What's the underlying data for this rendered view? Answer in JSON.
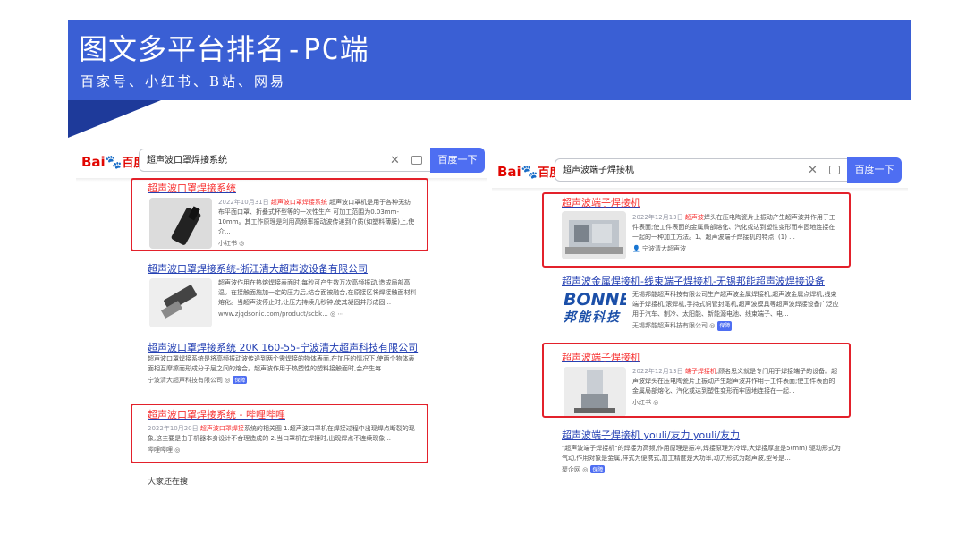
{
  "banner": {
    "title": "图文多平台排名-PC端",
    "subtitle": "百家号、小红书、B站、网易"
  },
  "colors": {
    "banner": "#3a5fd4",
    "banner_tab": "#1e3a9a",
    "highlight": "#e3212b",
    "link": "#2440b3",
    "baidu_button": "#4e6ef2"
  },
  "left_panel": {
    "logo": {
      "text_bai": "Bai",
      "text_du": "du",
      "text_cn": "百度"
    },
    "query": "超声波口罩焊接系统",
    "search_button": "百度一下",
    "results": [
      {
        "title": "超声波口罩焊接系统",
        "date": "2022年10月31日",
        "snippet_hl": "超声波口罩焊接系统",
        "snippet": "超声波口罩机是用于各种无纺布平面口罩、折叠式杯型等的一次性生产 可加工范围为0.03mm-10mm。其工作原理是利用高频率振动波传递到介质(如塑料薄膜)上,使介...",
        "source": "小红书"
      },
      {
        "title": "超声波口罩焊接系统-浙江清大超声波设备有限公司",
        "snippet": "超声波作用在热熔焊接表面时,每秒可产生数万次高频振动,造成局部高温。在接触面施加一定的压力后,结合面被融合,在原接区将焊接触面材料熔化。当超声波停止时,让压力持续几秒钟,使其凝固并形成固...",
        "source": "www.zjqdsonic.com/product/scbk..."
      },
      {
        "title": "超声波口罩焊接系统 20K 160-55-宁波清大超声科技有限公司",
        "snippet": "超声波口罩焊接系统是将高频振动波传递到两个需焊接的物体表面,在加压的情况下,使两个物体表面相互摩擦而形成分子层之间的熔合。超声波作用于热塑性的塑料接触面时,会产生每...",
        "source": "宁波清大超声科技有限公司",
        "badge": "保障"
      },
      {
        "title": "超声波口罩焊接系统 - 哔哩哔哩",
        "date": "2022年10月20日",
        "snippet_hl": "超声波口罩焊接",
        "snippet": "系统的相关图 1.超声波口罩机在焊接过程中出现焊点断裂的现象,这主要是由于机器本身设计不合理造成的 2.当口罩机在焊接时,出现焊点不连续现象...",
        "source": "哔哩哔哩"
      }
    ],
    "people_also": "大家还在搜"
  },
  "right_panel": {
    "logo": {
      "text_bai": "Bai",
      "text_du": "du",
      "text_cn": "百度"
    },
    "query": "超声波端子焊接机",
    "search_button": "百度一下",
    "results": [
      {
        "title": "超声波端子焊接机",
        "date": "2022年12月13日",
        "snippet_hl": "超声波",
        "snippet": "焊头在压电陶瓷片上振动产生超声波并作用于工件表面;使工件表面的金属局部熔化、汽化或达到塑性变形而牢固地连接在一起的一种加工方法。1、超声波端子焊接机的特点: (1) ...",
        "source": "宁波清大超声波"
      },
      {
        "title": "超声波金属焊接机-线束端子焊接机-无锡邦能超声波焊接设备",
        "snippet": "无锡邦能超声科技有限公司生产超声波金属焊接机,超声波金属点焊机,线束端子焊接机,滚焊机,手持式铜管封尾机,超声波模具等超声波焊接设备广泛应用于汽车、制冷、太阳能、新能源电池、线束端子、电...",
        "source": "无锡邦能超声科技有限公司",
        "badge": "保障",
        "logo_en": "BONNE",
        "logo_cn": "邦能科技"
      },
      {
        "title": "超声波端子焊接机",
        "date": "2022年12月13日",
        "snippet_hl": "端子焊接机",
        "snippet": ",顾名思义就是专门用于焊接端子的设备。超声波焊头在压电陶瓷片上振动产生超声波并作用于工件表面;使工件表面的金属局部熔化、汽化或达到塑性变形而牢固地连接在一起...",
        "source": "小红书"
      },
      {
        "title": "超声波端子焊接机 youli/友力 youli/友力",
        "snippet": "\"超声波端子焊接机\"的焊接为高频,作用原理是振冲,焊接原理为冷焊,大焊接厚度是5(mm) 驱动形式为气动,作用对象是金属,样式为便携式,加工精度是大功率,动力形式为超声波,型号是...",
        "source": "聚企网",
        "badge": "保障"
      }
    ]
  }
}
